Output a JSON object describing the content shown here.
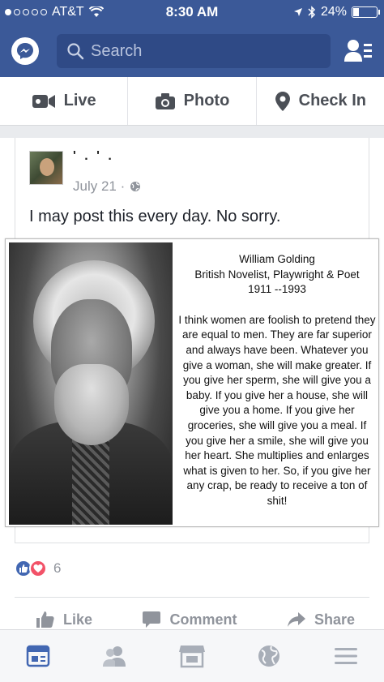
{
  "status": {
    "carrier": "AT&T",
    "time": "8:30 AM",
    "battery": "24%"
  },
  "nav": {
    "search_placeholder": "Search"
  },
  "composer": {
    "live_label": "Live",
    "photo_label": "Photo",
    "checkin_label": "Check In"
  },
  "post": {
    "author": "' . ' .",
    "date": "July 21 ·",
    "text": "I may post this every day.  No sorry.",
    "meme": {
      "name": "William Golding",
      "subtitle": "British Novelist, Playwright & Poet",
      "years": "1911 --1993",
      "quote": "I think women are foolish to pretend they are equal to men. They are far superior and always have been. Whatever you give a woman, she will make greater. If you give her sperm, she will give you a baby. If you give her a house, she will give you a home. If you give her groceries, she will give you a meal. If you give her a smile, she will give you her heart. She multiplies and enlarges what is given to her. So, if you give her any crap, be ready to receive a ton of shit!"
    },
    "reaction_count": "6",
    "actions": {
      "like": "Like",
      "comment": "Comment",
      "share": "Share"
    }
  },
  "colors": {
    "brand": "#3b5998",
    "like_blue": "#4267b2",
    "love_red": "#f25268",
    "muted": "#90949c"
  },
  "icons": [
    "messenger-icon",
    "search-icon",
    "friend-requests-icon",
    "video-icon",
    "camera-icon",
    "location-pin-icon",
    "globe-icon",
    "like-icon",
    "comment-icon",
    "share-icon",
    "news-feed-icon",
    "friends-icon",
    "marketplace-icon",
    "notifications-globe-icon",
    "menu-icon"
  ]
}
